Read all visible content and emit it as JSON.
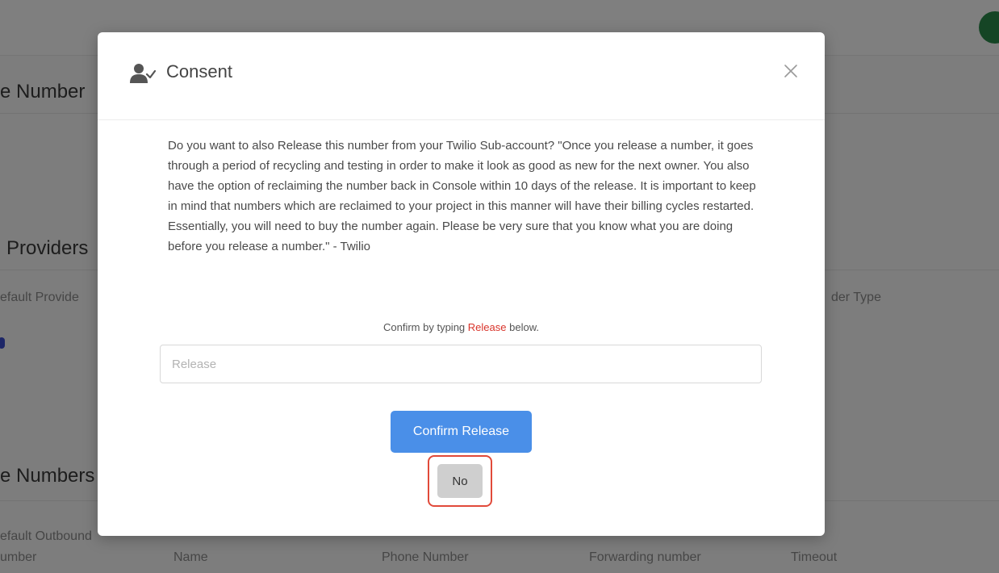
{
  "background": {
    "phone_numbers_heading": "e Number",
    "providers_heading": "Providers",
    "default_provider_label": "efault Provide",
    "provider_type_label": "der Type",
    "numbers_heading": "e Numbers",
    "columns": [
      "efault Outbound",
      "umber",
      "Name",
      "Phone Number",
      "Forwarding number",
      "Timeout"
    ]
  },
  "modal": {
    "title": "Consent",
    "body": "Do you want to also Release this number from your Twilio Sub-account? \"Once you release a number, it goes through a period of recycling and testing in order to make it look as good as new for the next owner. You also have the option of reclaiming the number back in Console within 10 days of the release. It is important to keep in mind that numbers which are reclaimed to your project in this manner will have their billing cycles restarted. Essentially, you will need to buy the number again. Please be very sure that you know what you are doing before you release a number.\" - Twilio",
    "hint_prefix": "Confirm by typing",
    "hint_keyword": "Release",
    "hint_suffix": "below.",
    "input_placeholder": "Release",
    "input_value": "",
    "confirm_label": "Confirm Release",
    "no_label": "No"
  },
  "colors": {
    "primary": "#4a8fe8",
    "keyword": "#d9342b",
    "highlight_border": "#e14a3a",
    "secondary_button": "#cfcfcf"
  },
  "icons": {
    "title_icon": "user-check-icon",
    "close": "close-icon"
  }
}
